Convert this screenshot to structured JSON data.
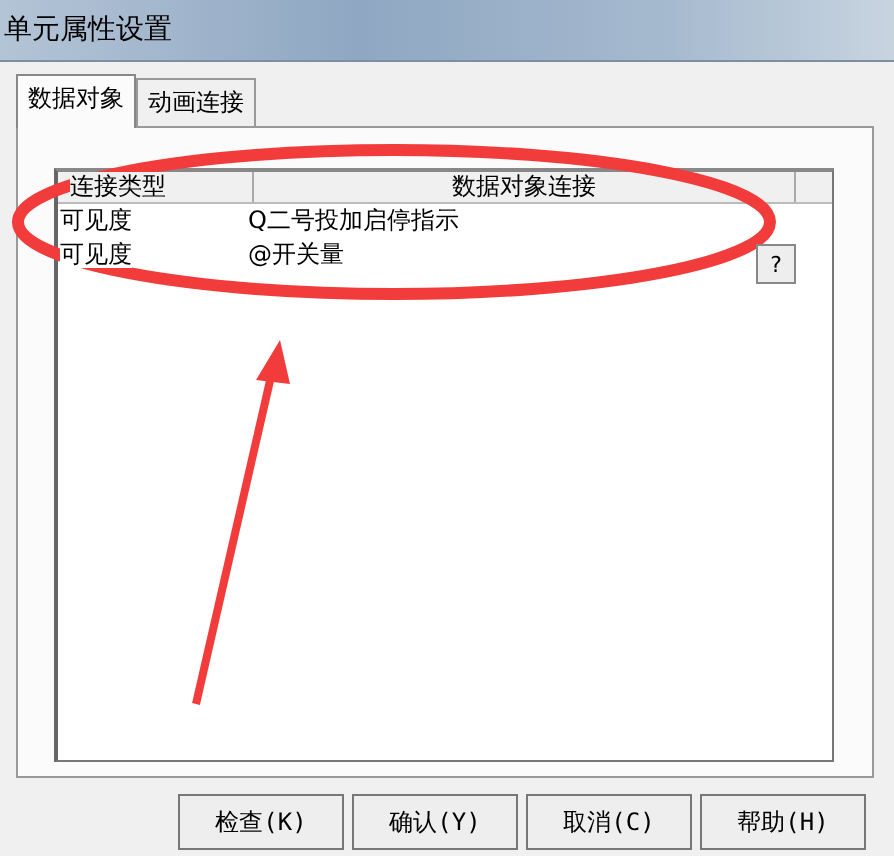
{
  "window": {
    "title": "单元属性设置"
  },
  "tabs": [
    {
      "label": "数据对象",
      "selected": true
    },
    {
      "label": "动画连接",
      "selected": false
    }
  ],
  "table": {
    "columns": [
      "连接类型",
      "数据对象连接"
    ],
    "rows": [
      {
        "type": "可见度",
        "link": "Q二号投加启停指示"
      },
      {
        "type": "可见度",
        "link": "@开关量"
      }
    ],
    "help_key": "?"
  },
  "buttons": [
    "检查(K)",
    "确认(Y)",
    "取消(C)",
    "帮助(H)"
  ]
}
